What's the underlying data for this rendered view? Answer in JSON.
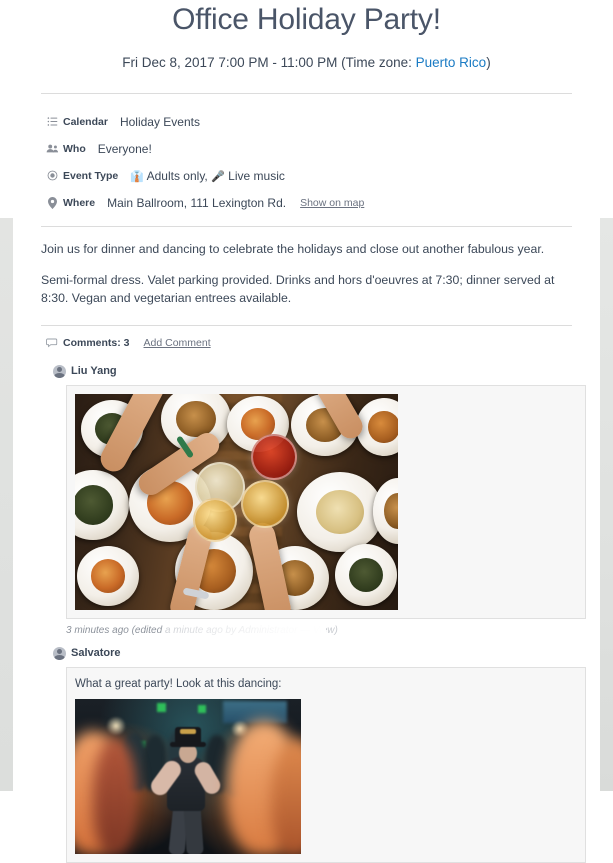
{
  "event": {
    "title": "Office Holiday Party!",
    "when_prefix": "Fri Dec 8, 2017 7:00 PM - 11:00 PM (Time zone: ",
    "timezone": "Puerto Rico",
    "when_suffix": ")"
  },
  "details": [
    {
      "icon": "list-icon",
      "label": "Calendar",
      "value": "Holiday Events"
    },
    {
      "icon": "people-icon",
      "label": "Who",
      "value": "Everyone!"
    },
    {
      "icon": "radio-icon",
      "label": "Event Type",
      "value": "Adults only,  Live music",
      "emoji1": "👔",
      "emoji2": "🎤",
      "part1": "Adults only,",
      "part2": "Live music"
    },
    {
      "icon": "pin-icon",
      "label": "Where",
      "value": "Main Ballroom, 111 Lexington Rd.",
      "link": "Show on map"
    }
  ],
  "description": [
    "Join us for dinner and dancing to celebrate the holidays and close out another fabulous year.",
    "Semi-formal dress. Valet parking provided. Drinks and hors d'oeuvres at 7:30; dinner served at 8:30. Vegan and vegetarian entrees available."
  ],
  "comments_bar": {
    "icon": "comment-bubble-icon",
    "count_label": "Comments: 3",
    "add_label": "Add Comment"
  },
  "comments": [
    {
      "author": "Liu Yang",
      "text": "",
      "photo": "dinner-table-cheers-photo",
      "meta_visible": "3 minutes ago (edited",
      "meta_faded": " a minute ago by Administrator — View)"
    },
    {
      "author": "Salvatore",
      "text": "What a great party! Look at this dancing:",
      "photo": "dance-floor-photo"
    }
  ],
  "colors": {
    "link": "#1a7bc4",
    "text": "#3c4858",
    "muted": "#6b7280",
    "rule": "#dcdcdc",
    "card_bg": "#f7f7f7",
    "card_border": "#e0e0e0",
    "gutter": "#e0e2e0"
  }
}
